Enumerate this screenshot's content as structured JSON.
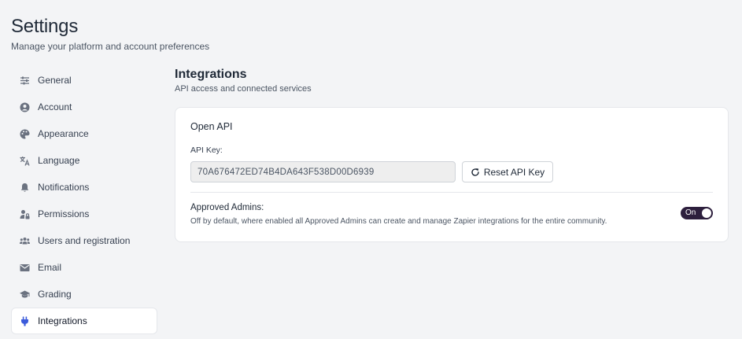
{
  "header": {
    "title": "Settings",
    "subtitle": "Manage your platform and account preferences"
  },
  "sidebar": {
    "items": [
      {
        "label": "General",
        "icon": "sliders-icon"
      },
      {
        "label": "Account",
        "icon": "user-circle-icon"
      },
      {
        "label": "Appearance",
        "icon": "palette-icon"
      },
      {
        "label": "Language",
        "icon": "translate-icon"
      },
      {
        "label": "Notifications",
        "icon": "bell-icon"
      },
      {
        "label": "Permissions",
        "icon": "user-lock-icon"
      },
      {
        "label": "Users and registration",
        "icon": "users-icon"
      },
      {
        "label": "Email",
        "icon": "envelope-icon"
      },
      {
        "label": "Grading",
        "icon": "graduation-cap-icon"
      },
      {
        "label": "Integrations",
        "icon": "plug-icon",
        "active": true
      }
    ]
  },
  "main": {
    "title": "Integrations",
    "subtitle": "API access and connected services",
    "card": {
      "title": "Open API",
      "api_key_label": "API Key:",
      "api_key_value": "70A676472ED74B4DA643F538D00D6939",
      "reset_button_label": "Reset API Key",
      "approved_admins_label": "Approved Admins:",
      "approved_admins_desc": "Off by default, where enabled all Approved Admins can create and manage Zapier integrations for the entire community.",
      "toggle_label": "On",
      "toggle_on": true
    }
  },
  "colors": {
    "background": "#f3f4f6",
    "card": "#ffffff",
    "accent": "#3b5bdb",
    "toggle_on": "#2d1f3d"
  }
}
